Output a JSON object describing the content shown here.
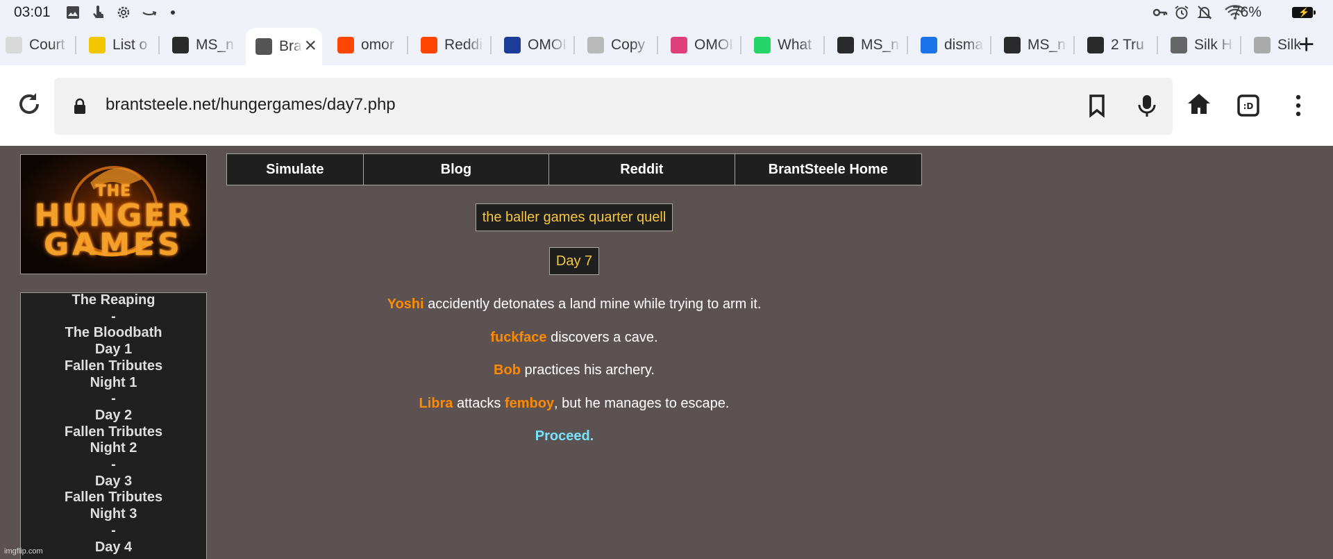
{
  "status_bar": {
    "time": "03:01",
    "battery": "76%"
  },
  "tabs": [
    {
      "title": "Court",
      "favicon": "document-icon",
      "color": "#d9d9d9"
    },
    {
      "title": "List o",
      "favicon": "fsdp-icon",
      "color": "#f2c600"
    },
    {
      "title": "MS_n",
      "favicon": "imgflip-icon",
      "color": "#2a2a2a"
    },
    {
      "title": "Bra",
      "favicon": "brantsteele-icon",
      "color": "#555555",
      "active": true
    },
    {
      "title": "omor",
      "favicon": "reddit-icon",
      "color": "#ff4500"
    },
    {
      "title": "Reddi",
      "favicon": "reddit-icon",
      "color": "#ff4500"
    },
    {
      "title": "OMOI",
      "favicon": "blue-square-icon",
      "color": "#1c3c9a"
    },
    {
      "title": "Copy",
      "favicon": "arm-icon",
      "color": "#b9b9b9"
    },
    {
      "title": "OMOI",
      "favicon": "colorful-icon",
      "color": "#e0407a"
    },
    {
      "title": "What",
      "favicon": "whatsapp-icon",
      "color": "#25d366"
    },
    {
      "title": "MS_n",
      "favicon": "imgflip-icon",
      "color": "#2a2a2a"
    },
    {
      "title": "disma",
      "favicon": "search-icon",
      "color": "#1a73e8"
    },
    {
      "title": "MS_n",
      "favicon": "imgflip-icon",
      "color": "#2a2a2a"
    },
    {
      "title": "2 Tru",
      "favicon": "imgflip-icon",
      "color": "#2a2a2a"
    },
    {
      "title": "Silk H",
      "favicon": "globe-icon",
      "color": "#666666"
    },
    {
      "title": "Silk",
      "favicon": "globe-icon",
      "color": "#aaaaaa"
    }
  ],
  "toolbar": {
    "url": "brantsteele.net/hungergames/day7.php"
  },
  "logo": {
    "line1": "THE",
    "line2": "HUNGER",
    "line3": "GAMES"
  },
  "nav": {
    "items": [
      "Simulate",
      "Blog",
      "Reddit",
      "BrantSteele Home"
    ]
  },
  "sidebar": {
    "items": [
      "The Reaping",
      "-",
      "The Bloodbath",
      "Day 1",
      "Fallen Tributes",
      "Night 1",
      "-",
      "Day 2",
      "Fallen Tributes",
      "Night 2",
      "-",
      "Day 3",
      "Fallen Tributes",
      "Night 3",
      "-",
      "Day 4"
    ]
  },
  "main": {
    "game_title": "the baller games quarter quell",
    "day_label": "Day 7",
    "events": [
      {
        "name1": "Yoshi",
        "text1": " accidently detonates a land mine while trying to arm it.",
        "name2": "",
        "text2": ""
      },
      {
        "name1": "fuckface",
        "text1": " discovers a cave.",
        "name2": "",
        "text2": ""
      },
      {
        "name1": "Bob",
        "text1": " practices his archery.",
        "name2": "",
        "text2": ""
      },
      {
        "name1": "Libra",
        "text1": " attacks ",
        "name2": "femboy",
        "text2": ", but he manages to escape."
      }
    ],
    "proceed": "Proceed."
  },
  "watermark": "imgflip.com",
  "colors": {
    "page_bg": "#5d5252",
    "panel_bg": "#1f1f1f",
    "tribute_name": "#ff8a00",
    "title_text": "#f7c63d",
    "proceed_link": "#77e3ff"
  }
}
